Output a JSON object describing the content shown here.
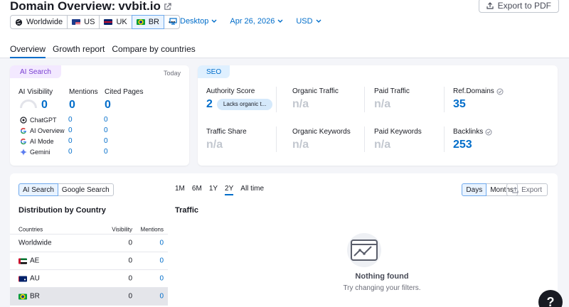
{
  "header": {
    "title_prefix": "Domain Overview:",
    "domain": "vvbit.io",
    "export_pdf": "Export to PDF",
    "databases": [
      {
        "label": "Worldwide",
        "active": false
      },
      {
        "label": "US",
        "active": false
      },
      {
        "label": "UK",
        "active": false
      },
      {
        "label": "BR",
        "active": true
      }
    ],
    "more": "•••",
    "device": "Desktop",
    "date": "Apr 26, 2026",
    "currency": "USD",
    "tabs": [
      "Overview",
      "Growth report",
      "Compare by countries"
    ]
  },
  "ai_card": {
    "badge": "AI Search",
    "today": "Today",
    "visibility_label": "AI Visibility",
    "visibility_value": "0",
    "mentions_label": "Mentions",
    "mentions_value": "0",
    "cited_label": "Cited Pages",
    "cited_value": "0",
    "models": [
      {
        "name": "ChatGPT",
        "mentions": "0",
        "cited": "0"
      },
      {
        "name": "AI Overview",
        "mentions": "0",
        "cited": "0"
      },
      {
        "name": "AI Mode",
        "mentions": "0",
        "cited": "0"
      },
      {
        "name": "Gemini",
        "mentions": "0",
        "cited": "0"
      }
    ]
  },
  "seo_card": {
    "badge": "SEO",
    "authority_label": "Authority Score",
    "authority_value": "2",
    "lacks_label": "Lacks organic t...",
    "organic_traffic_label": "Organic Traffic",
    "organic_traffic_value": "n/a",
    "paid_traffic_label": "Paid Traffic",
    "paid_traffic_value": "n/a",
    "ref_domains_label": "Ref.Domains",
    "ref_domains_value": "35",
    "traffic_share_label": "Traffic Share",
    "traffic_share_value": "n/a",
    "organic_keywords_label": "Organic Keywords",
    "organic_keywords_value": "n/a",
    "paid_keywords_label": "Paid Keywords",
    "paid_keywords_value": "n/a",
    "backlinks_label": "Backlinks",
    "backlinks_value": "253"
  },
  "bottom": {
    "search_toggle": [
      "AI Search",
      "Google Search"
    ],
    "ranges": [
      "1M",
      "6M",
      "1Y",
      "2Y",
      "All time"
    ],
    "active_range": "2Y",
    "granularity": [
      "Days",
      "Months"
    ],
    "export": "Export",
    "distribution_title": "Distribution by Country",
    "traffic_title": "Traffic",
    "table_headers": [
      "Countries",
      "Visibility",
      "Mentions"
    ],
    "rows": [
      {
        "country": "Worldwide",
        "visibility": "0",
        "mentions": "0"
      },
      {
        "country": "AE",
        "visibility": "0",
        "mentions": "0"
      },
      {
        "country": "AU",
        "visibility": "0",
        "mentions": "0"
      },
      {
        "country": "BR",
        "visibility": "0",
        "mentions": "0"
      }
    ],
    "empty_title": "Nothing found",
    "empty_subtitle": "Try changing your filters."
  },
  "help": "?",
  "colors": {
    "accent": "#006dca",
    "ai_badge": "#7a3fd1",
    "muted": "#c2c7cf"
  }
}
